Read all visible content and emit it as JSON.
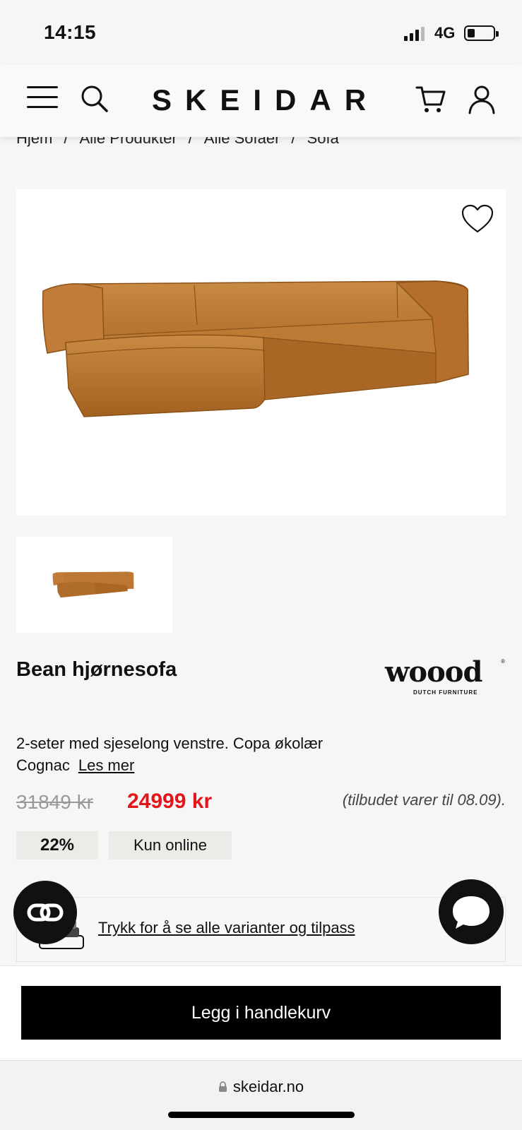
{
  "status_bar": {
    "time": "14:15",
    "network": "4G"
  },
  "header": {
    "logo": "SKEIDAR"
  },
  "breadcrumb": [
    "Hjem",
    "Alle Produkter",
    "Alle Sofaer",
    "Sofa"
  ],
  "breadcrumb_separator": "/",
  "product": {
    "title": "Bean hjørnesofa",
    "brand": {
      "name": "woood",
      "tagline": "DUTCH FURNITURE",
      "reg": "®"
    },
    "description": "2-seter med sjeselong venstre. Copa økolær Cognac",
    "read_more": "Les mer",
    "old_price": "31849 kr",
    "new_price": "24999 kr",
    "offer_note": "(tilbudet varer til 08.09).",
    "discount_badge": "22%",
    "online_badge": "Kun online",
    "variants_link": "Trykk for å se alle varianter og tilpass",
    "add_to_cart": "Legg i handlekurv"
  },
  "colors": {
    "sale_red": "#e3151b",
    "sofa_cognac": "#b8722e",
    "badge_bg": "#ebebe8"
  },
  "browser": {
    "url": "skeidar.no"
  }
}
